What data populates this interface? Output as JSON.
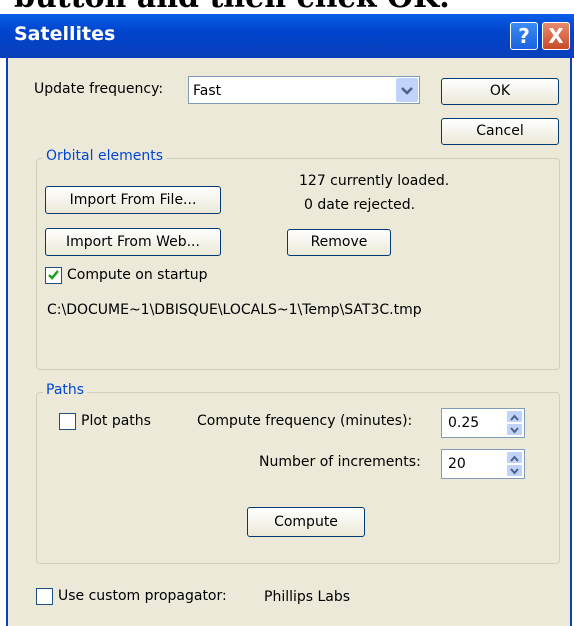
{
  "cropped_text": "button and then click OK.",
  "window": {
    "title": "Satellites"
  },
  "titlebar": {
    "help_glyph": "?",
    "close_glyph": "X"
  },
  "update": {
    "label": "Update frequency:",
    "value": "Fast"
  },
  "buttons": {
    "ok": "OK",
    "cancel": "Cancel"
  },
  "orbital": {
    "legend": "Orbital elements",
    "import_file": "Import From File...",
    "import_web": "Import From Web...",
    "loaded": "127 currently loaded.",
    "rejected": "0 date rejected.",
    "remove": "Remove",
    "compute_startup": "Compute on startup",
    "compute_startup_checked": true,
    "path": "C:\\DOCUME~1\\DBISQUE\\LOCALS~1\\Temp\\SAT3C.tmp"
  },
  "paths": {
    "legend": "Paths",
    "plot_paths": "Plot paths",
    "plot_paths_checked": false,
    "compute_freq_label": "Compute frequency (minutes):",
    "compute_freq_value": "0.25",
    "increments_label": "Number of increments:",
    "increments_value": "20",
    "compute_button": "Compute"
  },
  "propagator": {
    "label": "Use custom propagator:",
    "checked": false,
    "value": "Phillips Labs"
  },
  "icons": {
    "check": "checkmark-icon",
    "dropdown": "chevron-down-icon",
    "spin_up": "spin-up-icon",
    "spin_down": "spin-down-icon"
  }
}
